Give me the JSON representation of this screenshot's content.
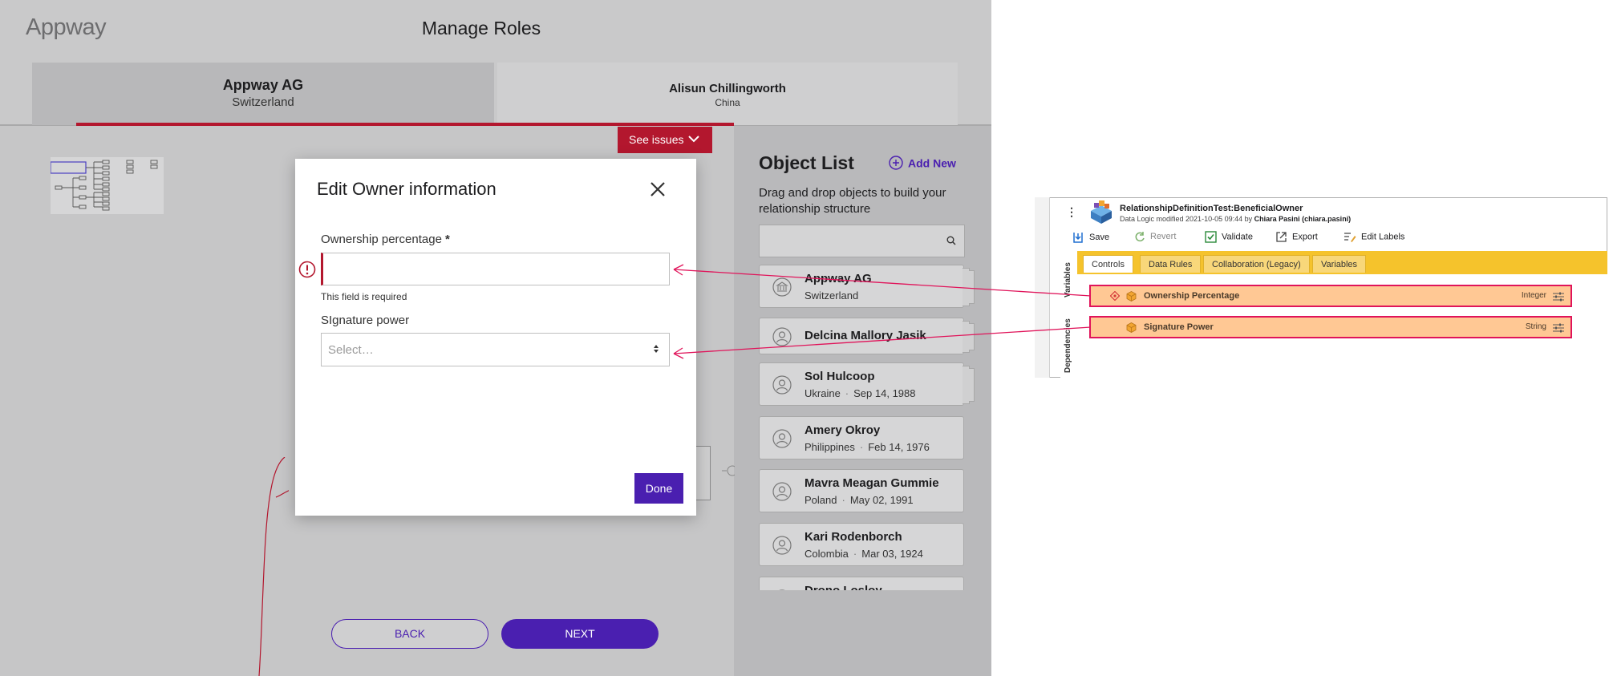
{
  "app": {
    "brand": "Appway",
    "page_title": "Manage Roles",
    "tabs": [
      {
        "title": "Appway AG",
        "subtitle": "Switzerland"
      },
      {
        "title": "Alisun Chillingworth",
        "subtitle": "China"
      }
    ],
    "see_issues_label": "See issues"
  },
  "modal": {
    "title": "Edit Owner information",
    "ownership_label": "Ownership percentage",
    "required_marker": "*",
    "ownership_value": "",
    "error_text": "This field is required",
    "signature_label": "SIgnature power",
    "signature_placeholder": "Select…",
    "done_label": "Done"
  },
  "footer": {
    "back_label": "BACK",
    "next_label": "NEXT"
  },
  "object_list": {
    "title": "Object List",
    "add_new_label": "Add New",
    "hint": "Drag and drop objects to build your relationship structure",
    "search_value": "",
    "items": [
      {
        "name": "Appway AG",
        "country": "Switzerland",
        "date": "",
        "kind": "bank-icon"
      },
      {
        "name": "Delcina Mallory Jasik",
        "country": "",
        "date": "",
        "kind": "person-icon"
      },
      {
        "name": "Sol Hulcoop",
        "country": "Ukraine",
        "date": "Sep 14, 1988",
        "kind": "person-icon"
      },
      {
        "name": "Amery Okroy",
        "country": "Philippines",
        "date": "Feb 14, 1976",
        "kind": "person-icon"
      },
      {
        "name": "Mavra Meagan Gummie",
        "country": "Poland",
        "date": "May 02, 1991",
        "kind": "person-icon"
      },
      {
        "name": "Kari Rodenborch",
        "country": "Colombia",
        "date": "Mar 03, 1924",
        "kind": "person-icon"
      },
      {
        "name": "Drono Losloy",
        "country": "",
        "date": "",
        "kind": "person-icon"
      }
    ]
  },
  "ide": {
    "title": "RelationshipDefinitionTest:BeneficialOwner",
    "subtitle_prefix": "Data Logic modified 2021-10-05 09:44 by",
    "subtitle_user": "Chiara Pasini (chiara.pasini)",
    "toolbar": {
      "save": "Save",
      "revert": "Revert",
      "validate": "Validate",
      "export": "Export",
      "edit_labels": "Edit Labels"
    },
    "vertical_tabs": [
      "Variables",
      "Dependencies"
    ],
    "tabs": [
      "Controls",
      "Data Rules",
      "Collaboration (Legacy)",
      "Variables"
    ],
    "rows": [
      {
        "name": "Ownership Percentage",
        "type": "Integer"
      },
      {
        "name": "Signature Power",
        "type": "String"
      }
    ]
  },
  "colors": {
    "accent_red": "#b3172e",
    "primary_purple": "#4a1fb0",
    "ide_yellow": "#f5c32c",
    "row_highlight": "#ffc894",
    "connector_pink": "#e0145a"
  }
}
